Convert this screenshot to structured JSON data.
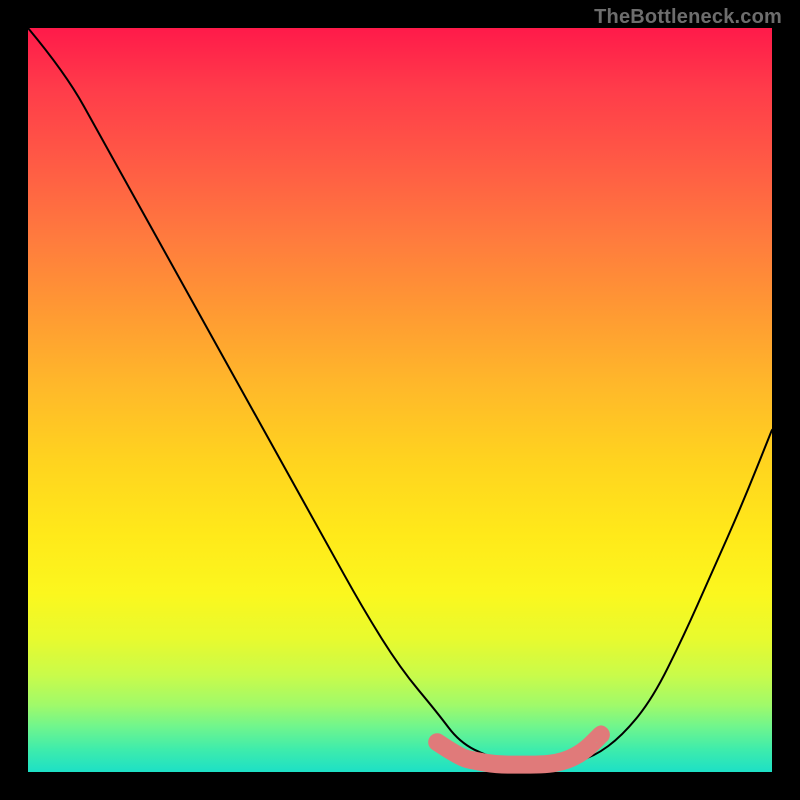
{
  "watermark": "TheBottleneck.com",
  "chart_data": {
    "type": "line",
    "title": "",
    "xlabel": "",
    "ylabel": "",
    "xlim": [
      0,
      100
    ],
    "ylim": [
      0,
      100
    ],
    "grid": false,
    "legend": false,
    "background_gradient": {
      "top": "#ff1a4a",
      "mid": "#ffe91a",
      "bottom": "#1de0c6"
    },
    "series": [
      {
        "name": "bottleneck-curve",
        "color": "#000000",
        "x": [
          0,
          5,
          10,
          15,
          20,
          25,
          30,
          35,
          40,
          45,
          50,
          55,
          58,
          62,
          66,
          70,
          72,
          76,
          80,
          84,
          88,
          92,
          96,
          100
        ],
        "y": [
          100,
          94,
          85,
          76,
          67,
          58,
          49,
          40,
          31,
          22,
          14,
          8,
          4,
          2,
          1,
          1,
          1,
          2,
          5,
          10,
          18,
          27,
          36,
          46
        ]
      },
      {
        "name": "bottom-accent",
        "color": "#e07a7a",
        "x": [
          55,
          58,
          60,
          63,
          66,
          69,
          71,
          73,
          75,
          77
        ],
        "y": [
          4,
          2,
          1.5,
          1,
          1,
          1,
          1.2,
          1.8,
          3,
          5
        ]
      }
    ],
    "annotations": []
  }
}
